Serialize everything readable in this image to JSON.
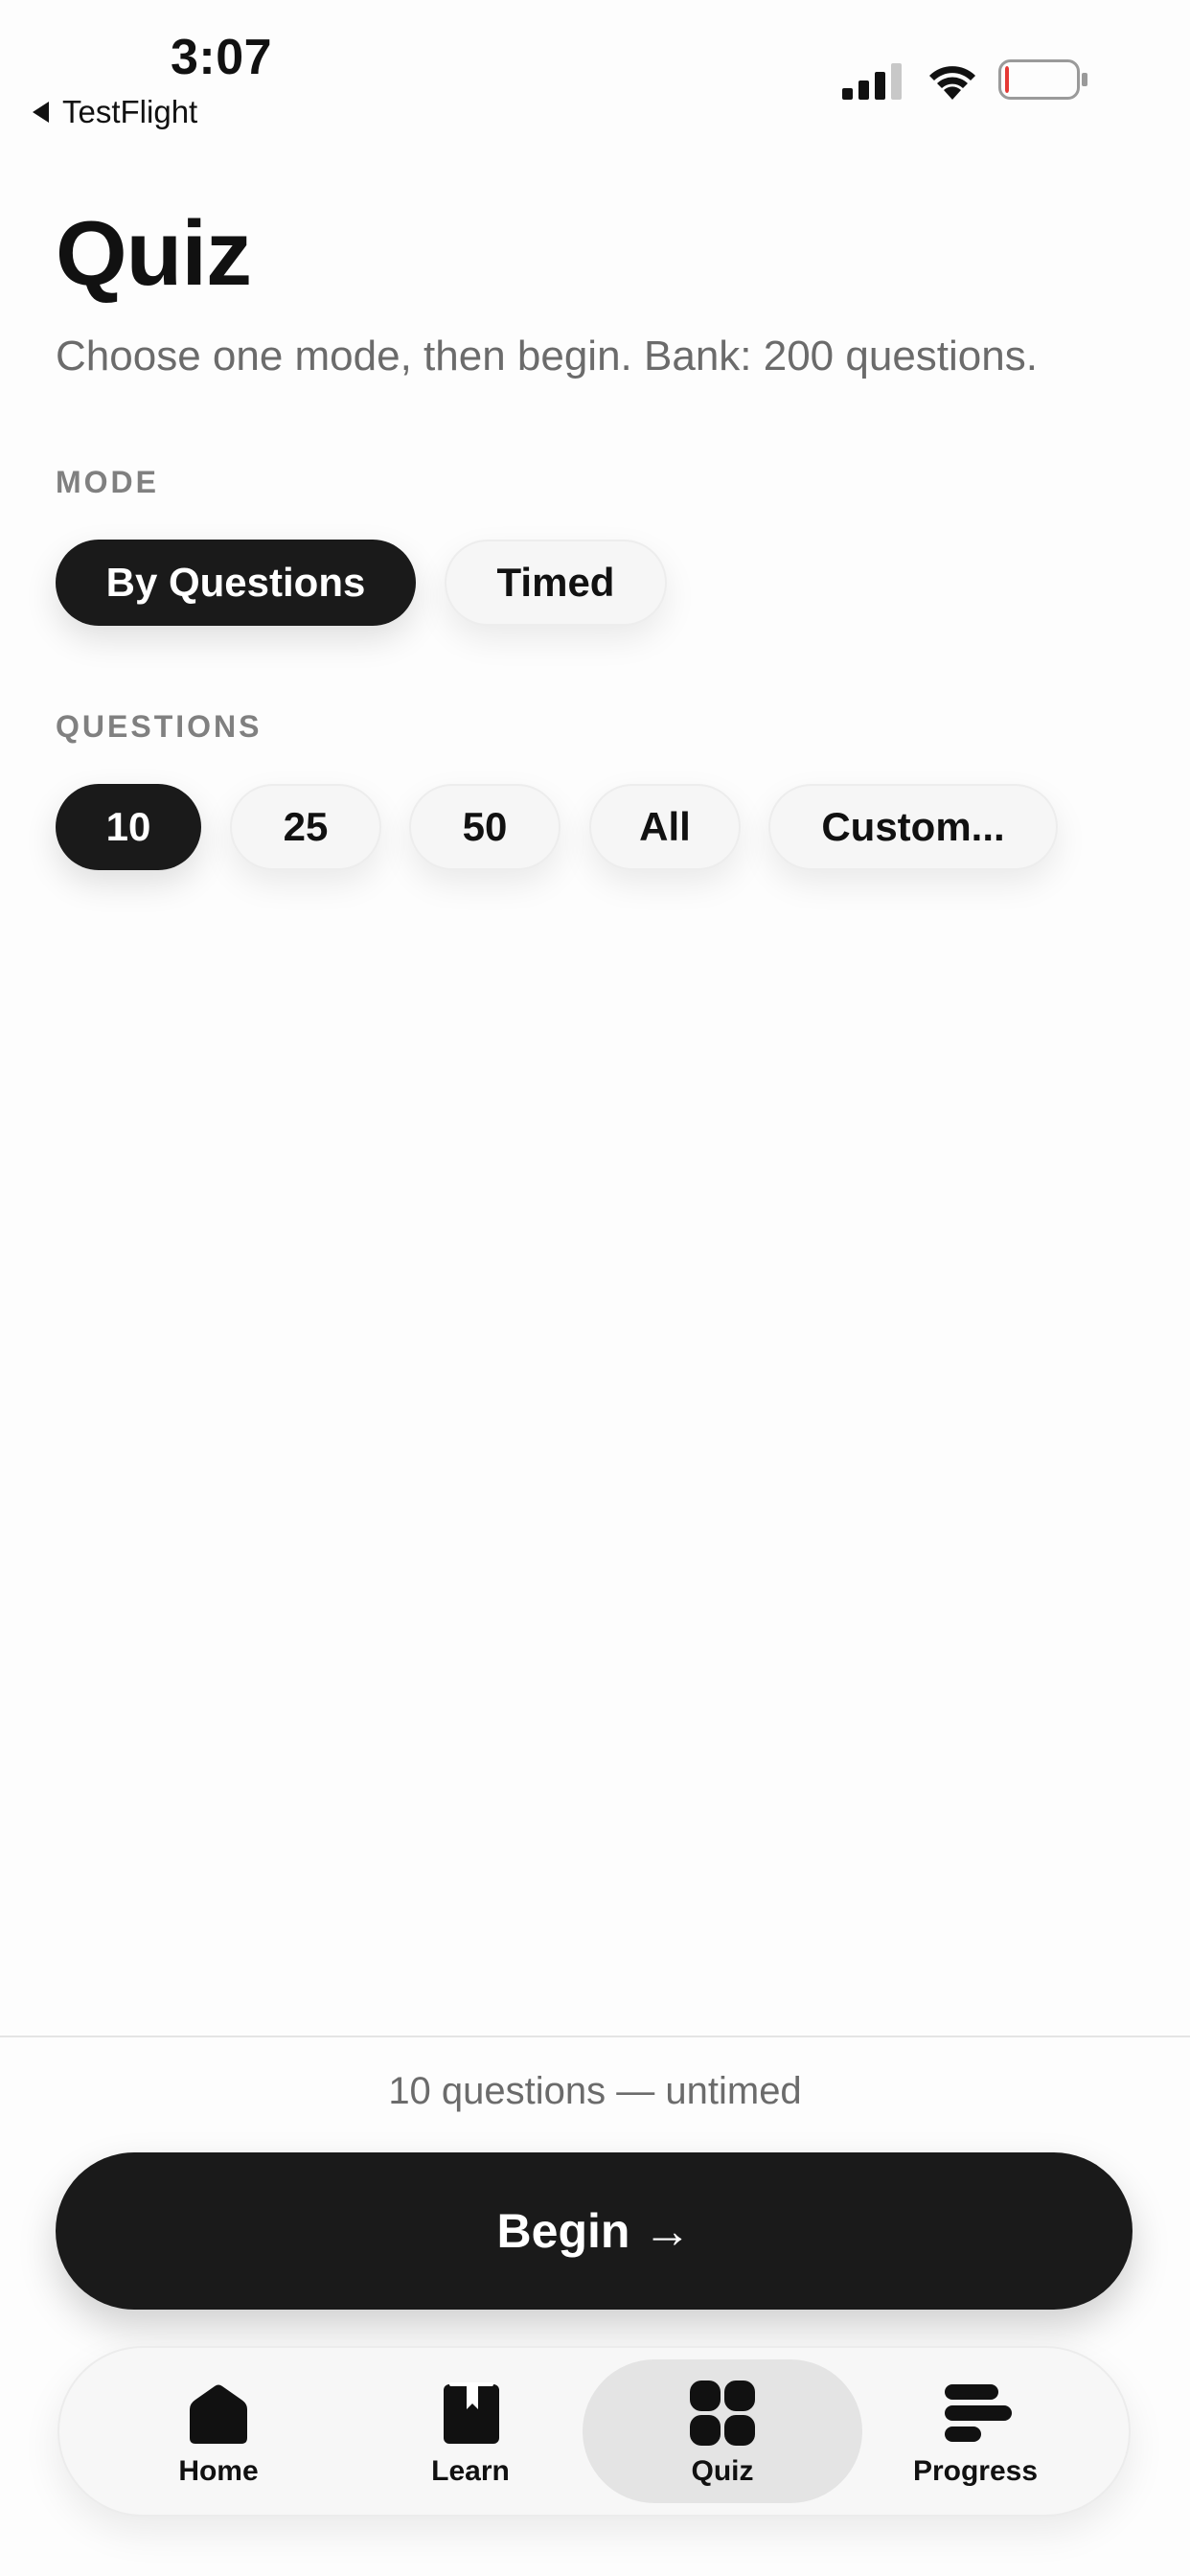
{
  "status_bar": {
    "time": "3:07",
    "back_app": "TestFlight",
    "battery_level": 0.05,
    "battery_color": "#e53935"
  },
  "header": {
    "title": "Quiz",
    "subtitle": "Choose one mode, then begin. Bank: 200 questions."
  },
  "mode": {
    "label": "MODE",
    "options": [
      "By Questions",
      "Timed"
    ],
    "selected": "By Questions"
  },
  "questions": {
    "label": "QUESTIONS",
    "options": [
      "10",
      "25",
      "50",
      "All",
      "Custom..."
    ],
    "selected": "10"
  },
  "footer": {
    "summary": "10 questions — untimed",
    "begin_label": "Begin",
    "begin_arrow": "→"
  },
  "tabbar": {
    "tabs": [
      {
        "label": "Home",
        "icon": "home-icon"
      },
      {
        "label": "Learn",
        "icon": "book-icon"
      },
      {
        "label": "Quiz",
        "icon": "grid-icon",
        "active": true
      },
      {
        "label": "Progress",
        "icon": "bars-icon"
      }
    ]
  },
  "colors": {
    "accent": "#1a1a1a",
    "background": "#fdfdfd"
  }
}
